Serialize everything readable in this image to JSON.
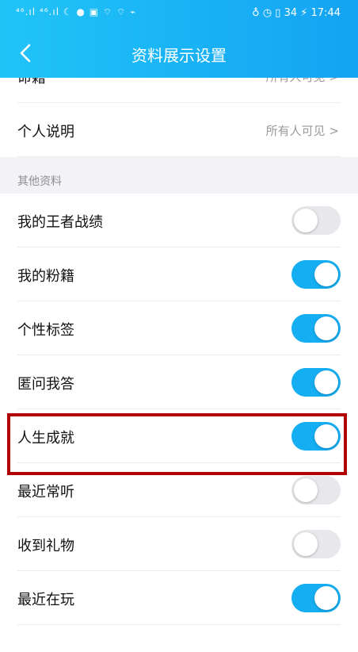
{
  "status_bar": {
    "left_icons": "⁴⁶.ıl ⁴⁶.ıl ☾ ● ▣ ⌔ ⌔ ⌁",
    "right_icons": "♁ ◷ ▯ 34 ⚡",
    "time": "17:44"
  },
  "header": {
    "title": "资料展示设置",
    "back_icon": "chevron-left-icon"
  },
  "partial_row": {
    "label": "命籍",
    "value": "所有人可见 >"
  },
  "rows_top": [
    {
      "label": "个人说明",
      "value": "所有人可见 >"
    }
  ],
  "section": {
    "label": "其他资料"
  },
  "toggle_rows": [
    {
      "label": "我的王者战绩",
      "enabled": false
    },
    {
      "label": "我的粉籍",
      "enabled": true
    },
    {
      "label": "个性标签",
      "enabled": true
    },
    {
      "label": "匿问我答",
      "enabled": true
    },
    {
      "label": "人生成就",
      "enabled": true
    },
    {
      "label": "最近常听",
      "enabled": false
    },
    {
      "label": "收到礼物",
      "enabled": false
    },
    {
      "label": "最近在玩",
      "enabled": true
    }
  ],
  "colors": {
    "accent": "#16aef3",
    "highlight": "#b00000",
    "toggle_off": "#e8e8ec"
  }
}
